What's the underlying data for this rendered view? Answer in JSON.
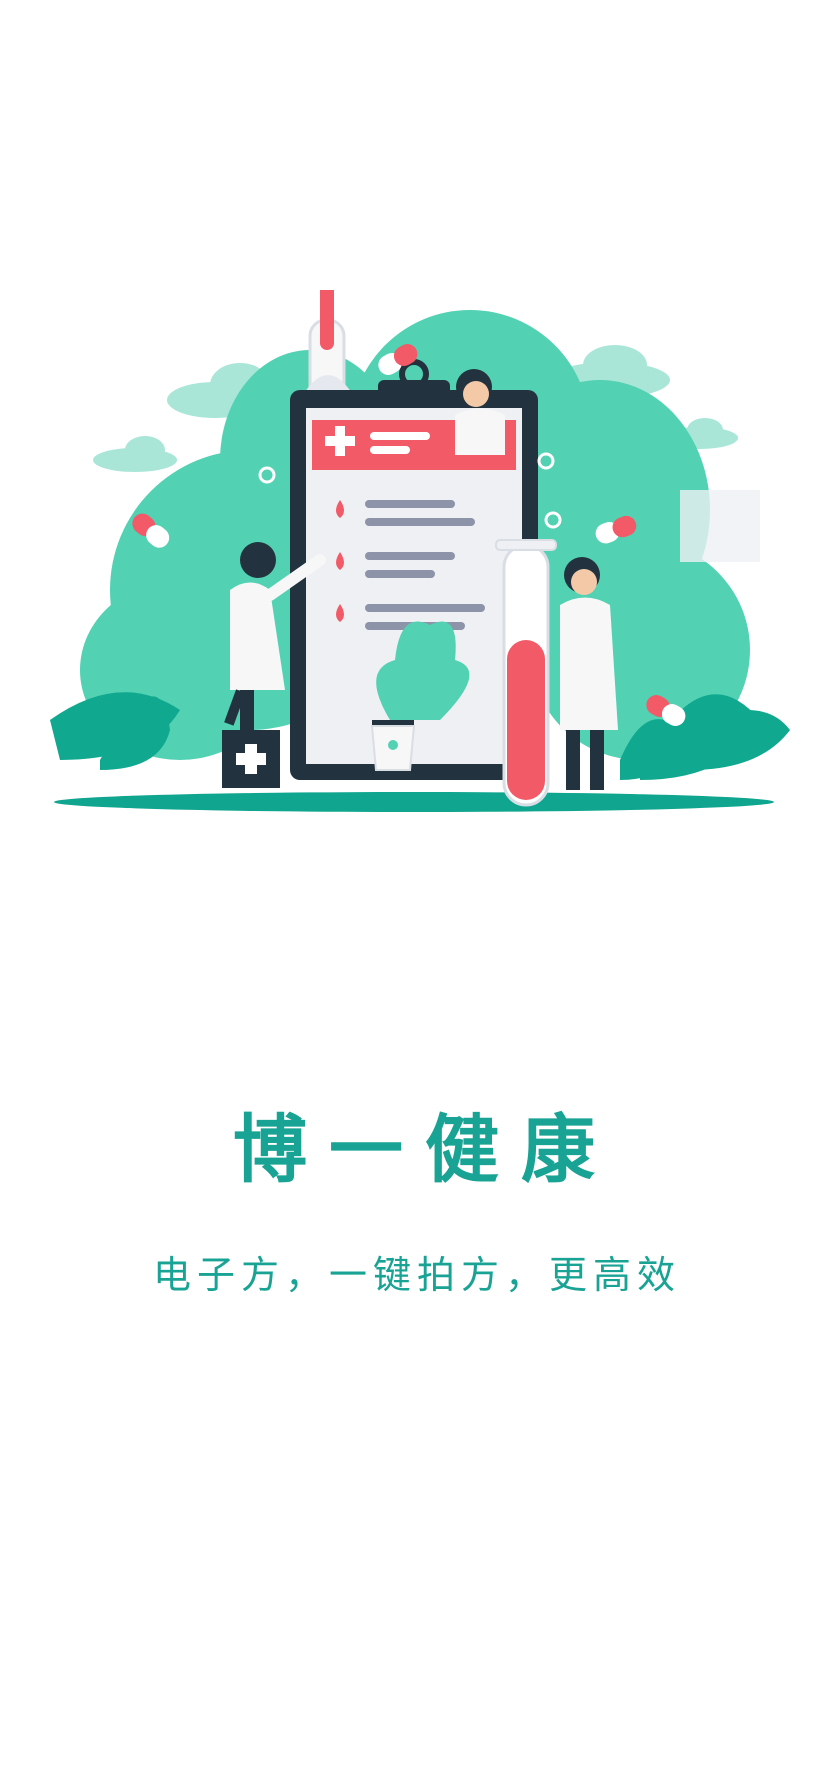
{
  "splash": {
    "title": "博一健康",
    "slogan": "电子方，一键拍方，更高效"
  },
  "colors": {
    "brand_teal": "#19a394",
    "leaf_green": "#4fd1b1",
    "dark_green": "#0fa58f",
    "accent_red": "#f25a67",
    "navy": "#22333f"
  },
  "illustration": {
    "subject": "medical-clipboard-with-doctors",
    "icons": [
      "clipboard-icon",
      "thermometer-icon",
      "test-tube-icon",
      "pill-icon",
      "first-aid-box-icon",
      "potted-plant-icon"
    ]
  }
}
